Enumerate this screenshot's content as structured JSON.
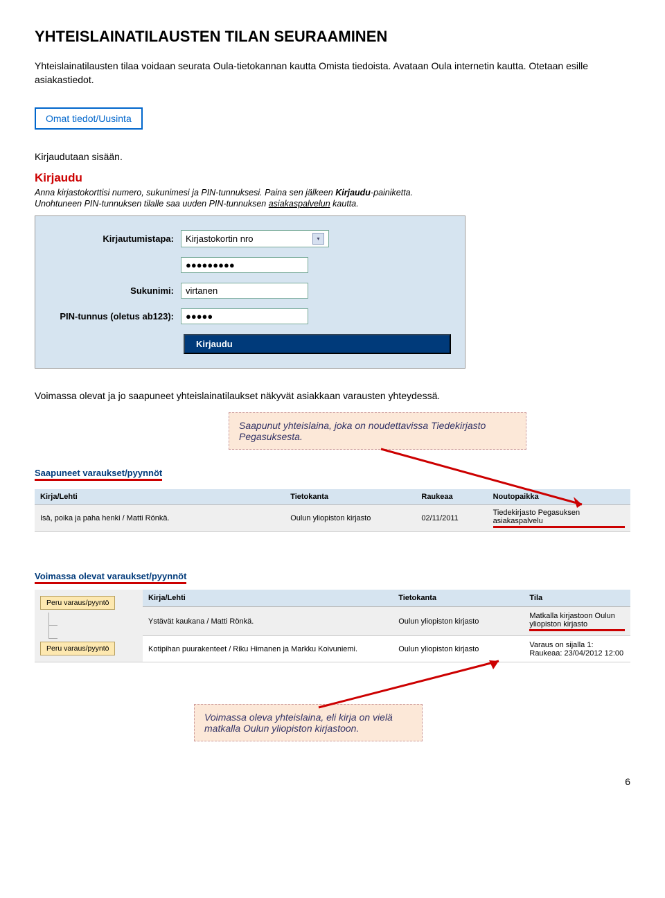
{
  "heading": "YHTEISLAINATILAUSTEN TILAN SEURAAMINEN",
  "intro1": "Yhteislainatilausten tilaa voidaan seurata Oula-tietokannan kautta Omista tiedoista. Avataan Oula internetin kautta. Otetaan esille asiakastiedot.",
  "tabLabel": "Omat tiedot/Uusinta",
  "intro2": "Kirjaudutaan sisään.",
  "login": {
    "title": "Kirjaudu",
    "line1_a": "Anna kirjastokorttisi numero, sukunimesi ja PIN-tunnuksesi. Paina sen jälkeen ",
    "line1_b": "Kirjaudu",
    "line1_c": "-painiketta.",
    "line2_a": "Unohtuneen PIN-tunnuksen tilalle saa uuden PIN-tunnuksen ",
    "line2_link": "asiakaspalvelun",
    "line2_b": " kautta.",
    "rows": {
      "method_label": "Kirjautumistapa:",
      "method_value": "Kirjastokortin nro",
      "card_value": "●●●●●●●●●",
      "surname_label": "Sukunimi:",
      "surname_value": "virtanen",
      "pin_label": "PIN-tunnus (oletus ab123):",
      "pin_value": "●●●●●",
      "submit": "Kirjaudu"
    }
  },
  "intro3": "Voimassa olevat ja jo saapuneet yhteislainatilaukset näkyvät asiakkaan varausten yhteydessä.",
  "callout1": "Saapunut yhteislaina, joka on noudettavissa Tiedekirjasto Pegasuksesta.",
  "section1": {
    "heading": "Saapuneet varaukset/pyynnöt",
    "cols": {
      "c1": "Kirja/Lehti",
      "c2": "Tietokanta",
      "c3": "Raukeaa",
      "c4": "Noutopaikka"
    },
    "row": {
      "c1": "Isä, poika ja paha henki / Matti Rönkä.",
      "c2": "Oulun yliopiston kirjasto",
      "c3": "02/11/2011",
      "c4": "Tiedekirjasto Pegasuksen asiakaspalvelu"
    }
  },
  "section2": {
    "heading": "Voimassa olevat varaukset/pyynnöt",
    "cancel": "Peru varaus/pyyntö",
    "cols": {
      "c1": "Kirja/Lehti",
      "c2": "Tietokanta",
      "c3": "Tila"
    },
    "rows": [
      {
        "c1": "Ystävät kaukana / Matti Rönkä.",
        "c2": "Oulun yliopiston kirjasto",
        "c3": "Matkalla kirjastoon Oulun yliopiston kirjasto"
      },
      {
        "c1": "Kotipihan puurakenteet / Riku Himanen ja Markku Koivuniemi.",
        "c2": "Oulun yliopiston kirjasto",
        "c3": "Varaus on sijalla 1: Raukeaa: 23/04/2012 12:00"
      }
    ]
  },
  "callout2": "Voimassa oleva yhteislaina, eli kirja on vielä matkalla Oulun yliopiston kirjastoon.",
  "pageNum": "6"
}
